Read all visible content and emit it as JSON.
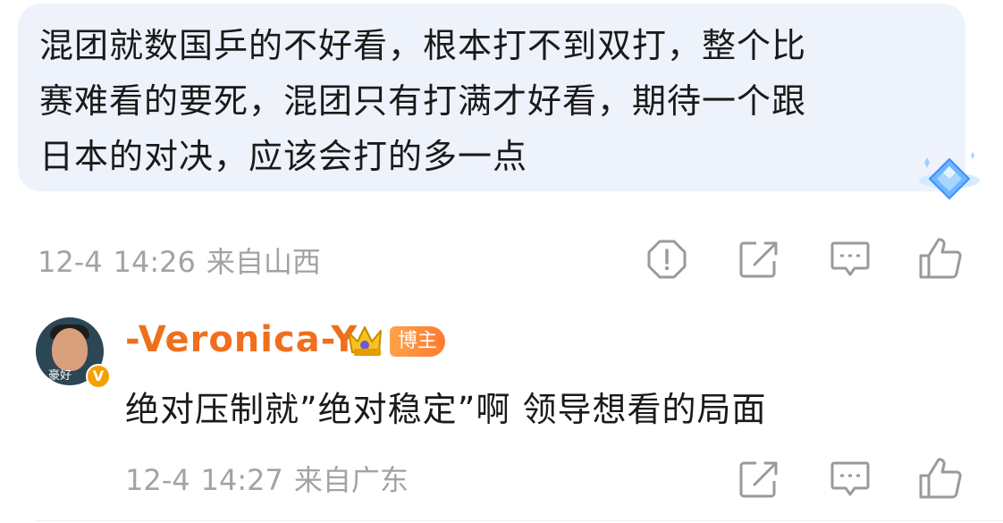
{
  "post": {
    "text_line1": "混团就数国乒的不好看，根本打不到双打，整个比",
    "text_line2": "赛难看的要死，混团只有打满才好看，期待一个跟",
    "text_line3": "日本的对决，应该会打的多一点",
    "date": "12-4",
    "time": "14:26",
    "location": "来自山西"
  },
  "reply": {
    "username": "-Veronica-Y",
    "avatar_text": "豪好",
    "verified_mark": "V",
    "badge_label": "博主",
    "text": "绝对压制就”绝对稳定”啊 领导想看的局面",
    "date": "12-4",
    "time": "14:27",
    "location": "来自广东"
  },
  "colors": {
    "bubble_bg": "#eef2fb",
    "username": "#ef6f1d",
    "meta": "#a3a3a3",
    "icon": "#9a9a9a"
  }
}
